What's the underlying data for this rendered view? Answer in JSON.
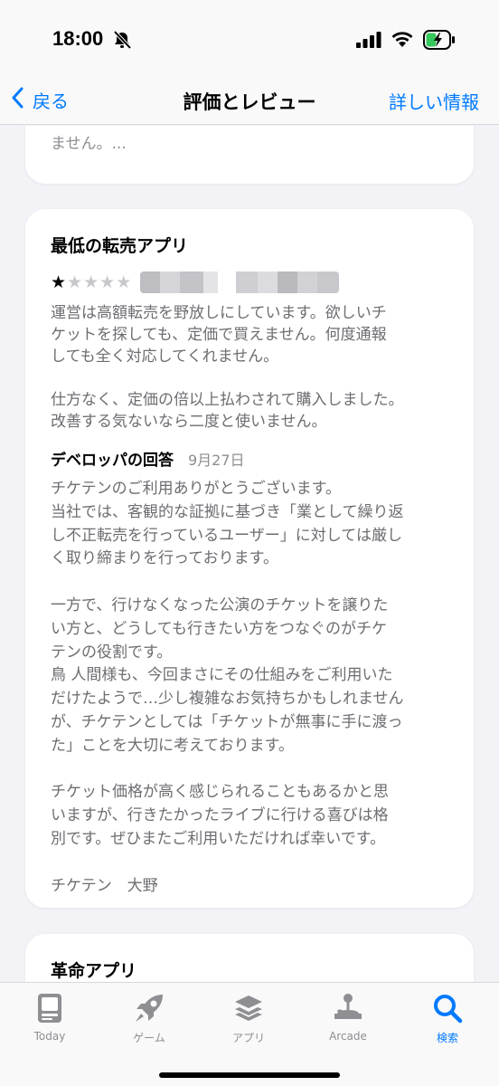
{
  "status": {
    "time": "18:00"
  },
  "nav": {
    "back_label": "戻る",
    "title": "評価とレビュー",
    "right_label": "詳しい情報"
  },
  "previous_review": {
    "text_tail": "ません。..."
  },
  "review": {
    "title": "最低の転売アプリ",
    "rating": 1,
    "rating_max": 5,
    "body": "運営は高額転売を野放しにしています。欲しいチ\nケットを探しても、定価で買えません。何度通報\nしても全く対応してくれません。\n\n仕方なく、定価の倍以上払わされて購入しました。\n改善する気ないなら二度と使いません。",
    "developer_response": {
      "label": "デベロッパの回答",
      "date": "9月27日",
      "text": "チケテンのご利用ありがとうございます。\n当社では、客観的な証拠に基づき「業として繰り返\nし不正転売を行っているユーザー」に対しては厳し\nく取り締まりを行っております。\n\n一方で、行けなくなった公演のチケットを譲りた\nい方と、どうしても行きたい方をつなぐのがチケ\nテンの役割です。\n鳥 人間様も、今回まさにその仕組みをご利用いた\nだけたようで…少し複雑なお気持ちかもしれません\nが、チケテンとしては「チケットが無事に手に渡っ\nた」ことを大切に考えております。\n\nチケット価格が高く感じられることもあるかと思\nいますが、行きたかったライブに行ける喜びは格\n別です。ぜひまたご利用いただければ幸いです。\n\nチケテン　大野"
    }
  },
  "next_review": {
    "title": "革命アプリ"
  },
  "tabs": [
    {
      "label": "Today",
      "icon": "today-icon",
      "active": false
    },
    {
      "label": "ゲーム",
      "icon": "rocket-icon",
      "active": false
    },
    {
      "label": "アプリ",
      "icon": "layers-icon",
      "active": false
    },
    {
      "label": "Arcade",
      "icon": "joystick-icon",
      "active": false
    },
    {
      "label": "検索",
      "icon": "search-icon",
      "active": true
    }
  ],
  "colors": {
    "accent": "#007aff",
    "secondary_text": "#6d6d72",
    "background": "#f2f2f7"
  }
}
